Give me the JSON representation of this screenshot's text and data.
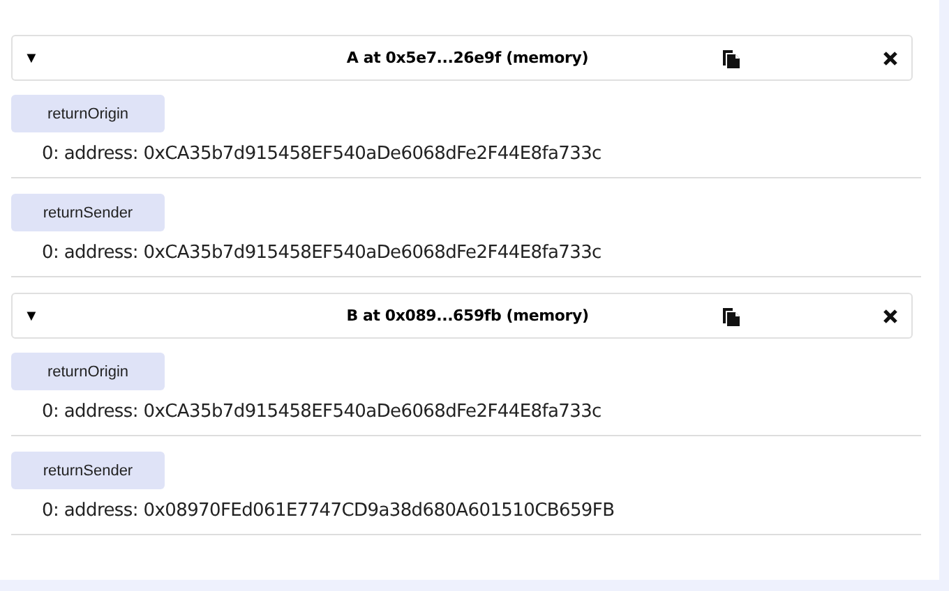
{
  "instances": [
    {
      "toggle": "▼",
      "title": "A at 0x5e7...26e9f (memory)",
      "functions": [
        {
          "label": "returnOrigin",
          "result": "0: address: 0xCA35b7d915458EF540aDe6068dFe2F44E8fa733c"
        },
        {
          "label": "returnSender",
          "result": "0: address: 0xCA35b7d915458EF540aDe6068dFe2F44E8fa733c"
        }
      ]
    },
    {
      "toggle": "▼",
      "title": "B at 0x089...659fb (memory)",
      "functions": [
        {
          "label": "returnOrigin",
          "result": "0: address: 0xCA35b7d915458EF540aDe6068dFe2F44E8fa733c"
        },
        {
          "label": "returnSender",
          "result": "0: address: 0x08970FEd061E7747CD9a38d680A601510CB659FB"
        }
      ]
    }
  ]
}
